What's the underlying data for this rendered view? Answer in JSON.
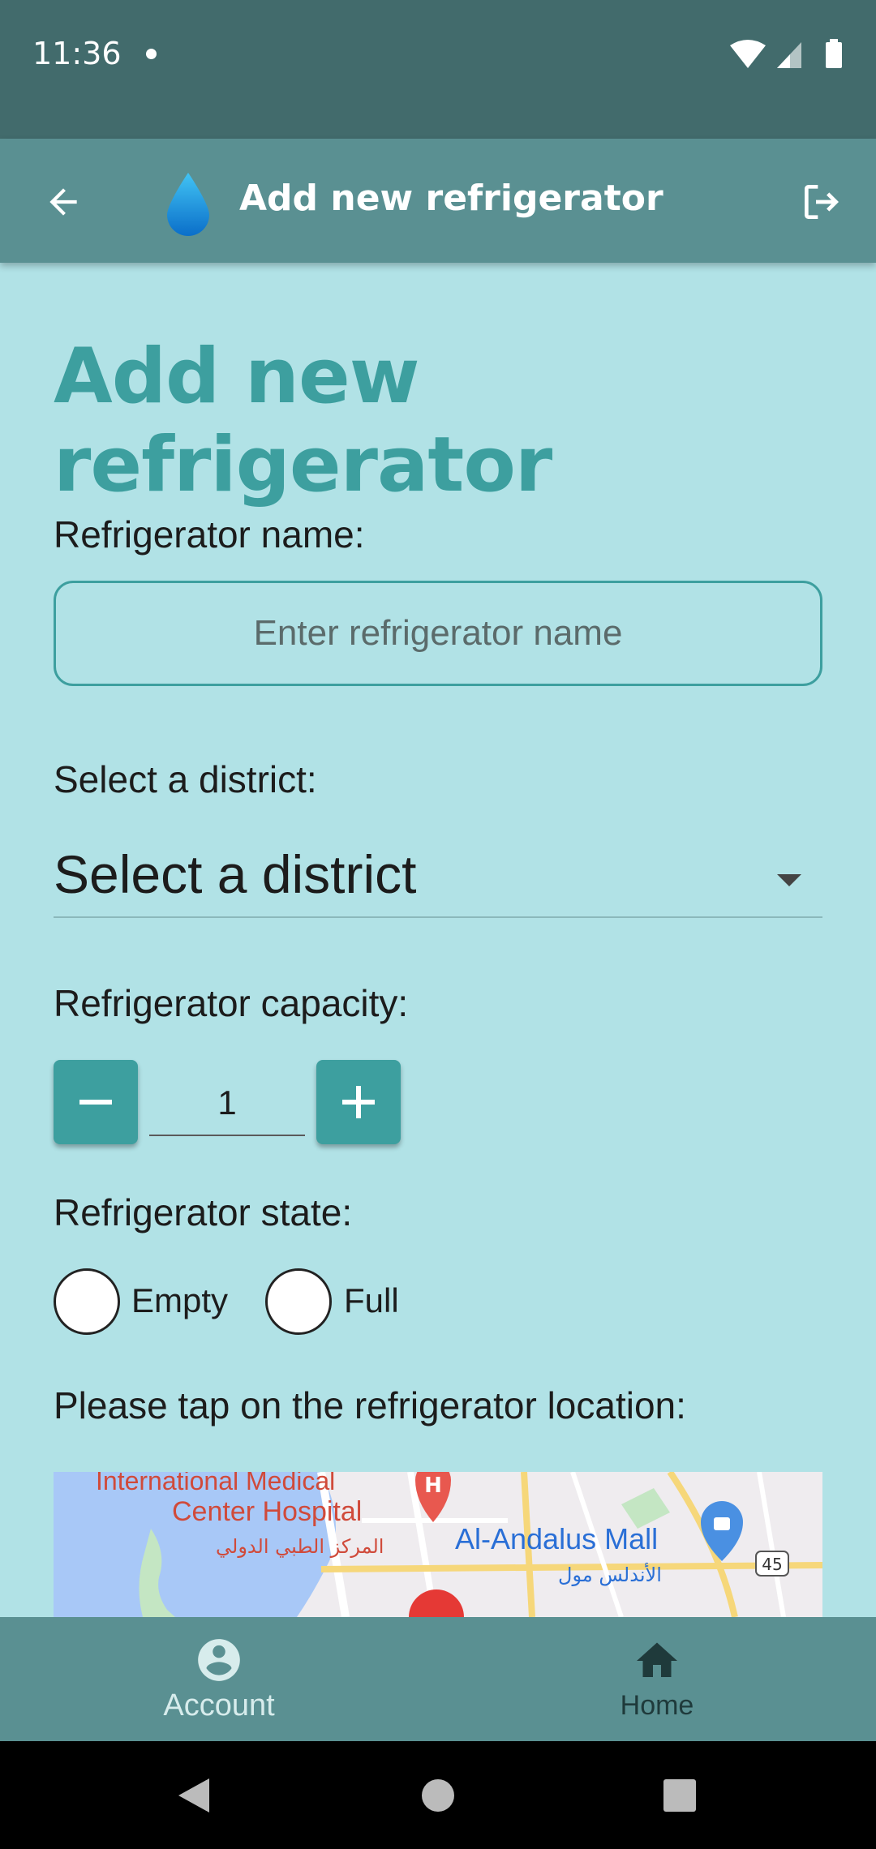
{
  "status_bar": {
    "time": "11:36"
  },
  "app_bar": {
    "title": "Add new refrigerator"
  },
  "page": {
    "title": "Add new refrigerator",
    "name_label": "Refrigerator name:",
    "name_placeholder": "Enter refrigerator name",
    "name_value": "",
    "district_label": "Select a district:",
    "district_value": "Select a district",
    "capacity_label": "Refrigerator capacity:",
    "capacity_value": "1",
    "state_label": "Refrigerator state:",
    "state_options": [
      "Empty",
      "Full"
    ],
    "location_label": "Please tap on the refrigerator location:"
  },
  "map": {
    "labels": {
      "hospital_en_1": "International Medical",
      "hospital_en_2": "Center Hospital",
      "hospital_ar": "المركز الطبي الدولي",
      "mall_en": "Al-Andalus Mall",
      "mall_ar": "الأندلس مول",
      "road_shield": "45"
    }
  },
  "bottom_nav": {
    "account": "Account",
    "home": "Home"
  },
  "colors": {
    "accent": "#3d9f9f",
    "app_bar": "#5a9092",
    "status_bar": "#426b6c",
    "background": "#b1e2e6"
  }
}
